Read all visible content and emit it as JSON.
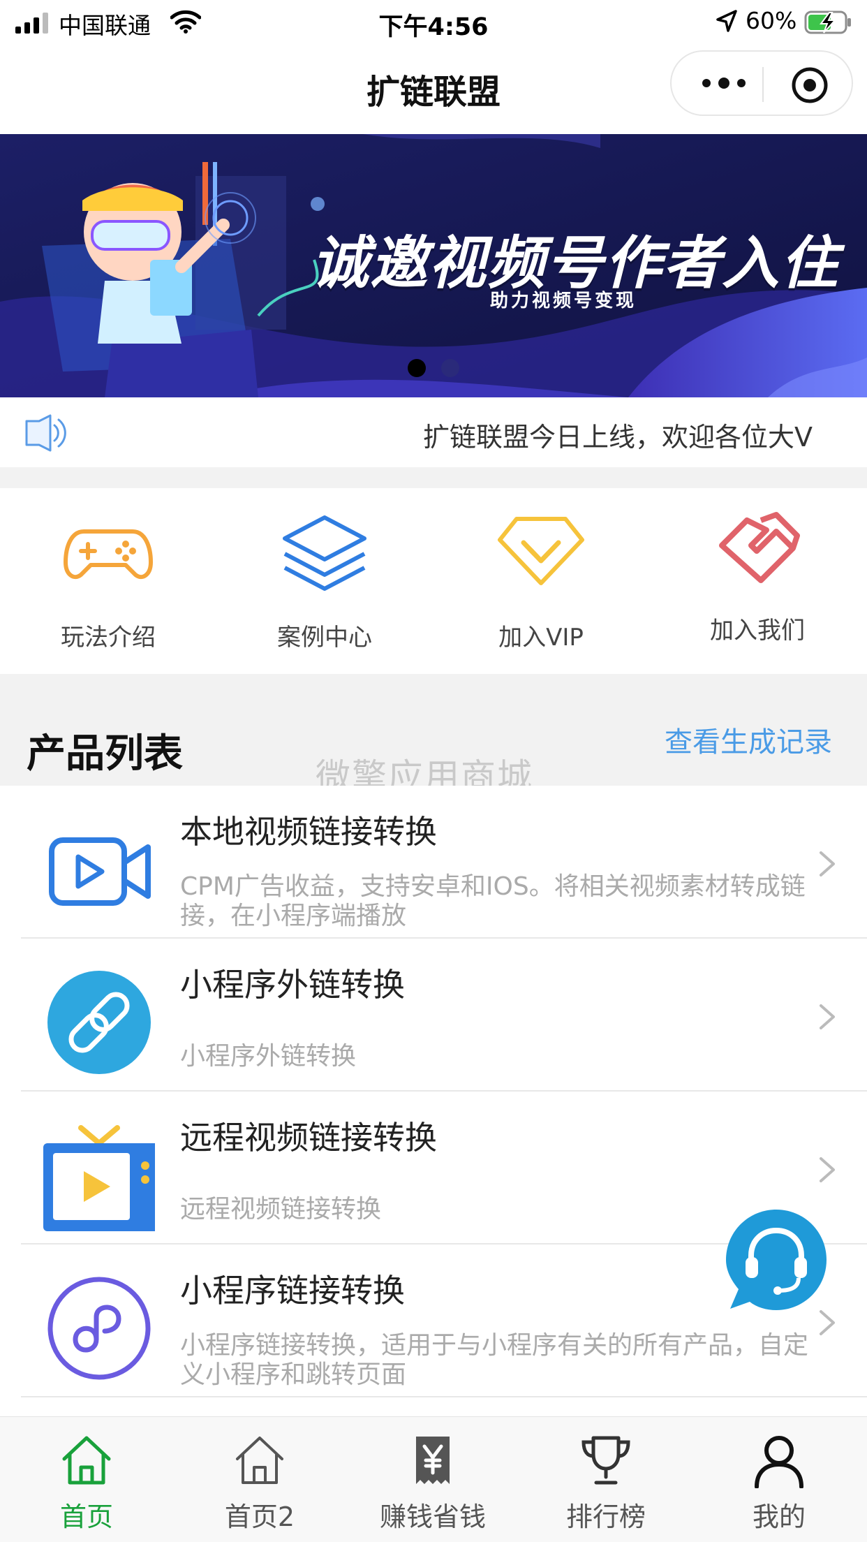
{
  "status_bar": {
    "carrier": "中国联通",
    "time": "下午4:56",
    "battery": "60%"
  },
  "nav": {
    "title": "扩链联盟",
    "more_icon": "more-dots-icon",
    "close_icon": "target-icon"
  },
  "banner": {
    "headline": "诚邀视频号作者入住",
    "subtitle": "助力视频号变现",
    "slide_count": 2,
    "active_slide": 1
  },
  "notice": {
    "text": "扩链联盟今日上线，欢迎各位大V"
  },
  "menu": [
    {
      "label": "玩法介绍",
      "icon": "gamepad-icon",
      "color": "#f5a53a"
    },
    {
      "label": "案例中心",
      "icon": "layers-icon",
      "color": "#2f7de1"
    },
    {
      "label": "加入VIP",
      "icon": "vip-diamond-icon",
      "color": "#f6c33b"
    },
    {
      "label": "加入我们",
      "icon": "handshake-icon",
      "color": "#e0636a"
    }
  ],
  "products": {
    "title": "产品列表",
    "history_link": "查看生成记录",
    "watermark": "微擎应用商城",
    "items": [
      {
        "title": "本地视频链接转换",
        "desc": "CPM广告收益，支持安卓和IOS。将相关视频素材转成链接，在小程序端播放",
        "icon": "video-camera-icon"
      },
      {
        "title": "小程序外链转换",
        "desc": "小程序外链转换",
        "icon": "link-icon"
      },
      {
        "title": "远程视频链接转换",
        "desc": "远程视频链接转换",
        "icon": "tv-play-icon"
      },
      {
        "title": "小程序链接转换",
        "desc": "小程序链接转换，适用于与小程序有关的所有产品，自定义小程序和跳转页面",
        "icon": "mini-program-icon"
      }
    ]
  },
  "support_icon": "customer-service-icon",
  "tabs": [
    {
      "label": "首页",
      "icon": "home-icon",
      "active": true
    },
    {
      "label": "首页2",
      "icon": "home-icon",
      "active": false
    },
    {
      "label": "赚钱省钱",
      "icon": "yen-ticket-icon",
      "active": false
    },
    {
      "label": "排行榜",
      "icon": "trophy-icon",
      "active": false
    },
    {
      "label": "我的",
      "icon": "user-icon",
      "active": false
    }
  ],
  "colors": {
    "accent_green": "#19a13b",
    "link_blue": "#4a9be6",
    "banner_bg": "#161a55"
  }
}
